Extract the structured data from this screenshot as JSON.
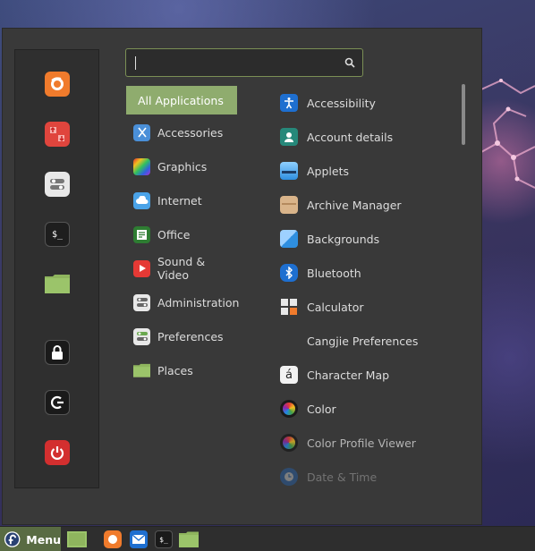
{
  "search": {
    "value": "",
    "placeholder": ""
  },
  "categories": [
    {
      "label": "All Applications",
      "icon": "all-applications",
      "active": true
    },
    {
      "label": "Accessories",
      "icon": "accessories-icon"
    },
    {
      "label": "Graphics",
      "icon": "graphics-icon"
    },
    {
      "label": "Internet",
      "icon": "internet-icon"
    },
    {
      "label": "Office",
      "icon": "office-icon"
    },
    {
      "label": "Sound & Video",
      "icon": "sound-video-icon"
    },
    {
      "label": "Administration",
      "icon": "administration-icon"
    },
    {
      "label": "Preferences",
      "icon": "preferences-icon"
    },
    {
      "label": "Places",
      "icon": "folder-icon"
    }
  ],
  "apps": [
    {
      "label": "Accessibility",
      "icon": "accessibility-icon"
    },
    {
      "label": "Account details",
      "icon": "account-icon"
    },
    {
      "label": "Applets",
      "icon": "applets-icon"
    },
    {
      "label": "Archive Manager",
      "icon": "archive-icon"
    },
    {
      "label": "Backgrounds",
      "icon": "backgrounds-icon"
    },
    {
      "label": "Bluetooth",
      "icon": "bluetooth-icon"
    },
    {
      "label": "Calculator",
      "icon": "calculator-icon"
    },
    {
      "label": "Cangjie Preferences",
      "icon": ""
    },
    {
      "label": "Character Map",
      "icon": "character-map-icon"
    },
    {
      "label": "Color",
      "icon": "color-icon"
    },
    {
      "label": "Color Profile Viewer",
      "icon": "color-profile-icon"
    },
    {
      "label": "Date & Time",
      "icon": "clock-icon"
    }
  ],
  "favorites": [
    "firefox-icon",
    "software-manager-icon",
    "settings-icon",
    "terminal-icon",
    "files-icon",
    "lock-icon",
    "logout-icon",
    "power-icon"
  ],
  "taskbar": {
    "menu_label": "Menu",
    "launchers": [
      "show-desktop-icon",
      "firefox-icon",
      "mail-icon",
      "terminal-icon",
      "files-icon"
    ]
  },
  "colors": {
    "accent": "#8fac6e",
    "menu_bg": "#393939",
    "taskbar_menu": "#596b43"
  }
}
